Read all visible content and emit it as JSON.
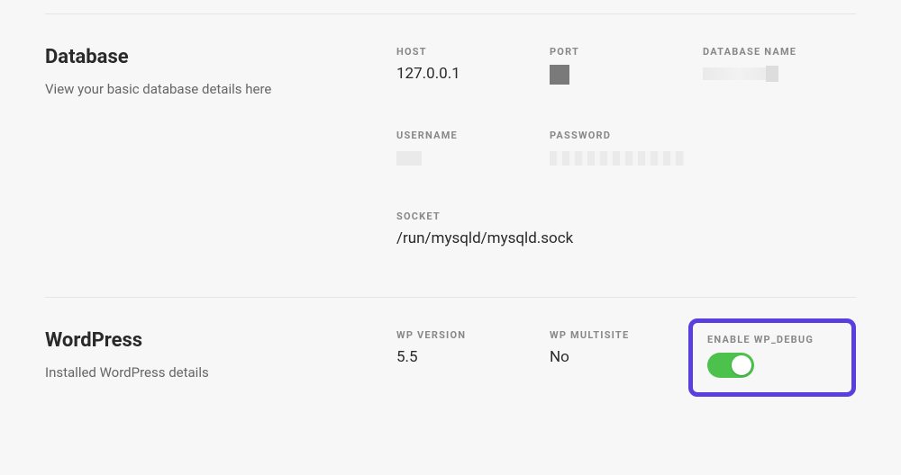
{
  "database": {
    "title": "Database",
    "description": "View your basic database details here",
    "fields": {
      "host": {
        "label": "HOST",
        "value": "127.0.0.1"
      },
      "port": {
        "label": "PORT"
      },
      "database_name": {
        "label": "DATABASE NAME"
      },
      "username": {
        "label": "USERNAME"
      },
      "password": {
        "label": "PASSWORD"
      },
      "socket": {
        "label": "SOCKET",
        "value": "/run/mysqld/mysqld.sock"
      }
    }
  },
  "wordpress": {
    "title": "WordPress",
    "description": "Installed WordPress details",
    "fields": {
      "wp_version": {
        "label": "WP VERSION",
        "value": "5.5"
      },
      "wp_multisite": {
        "label": "WP MULTISITE",
        "value": "No"
      },
      "enable_wp_debug": {
        "label": "ENABLE WP_DEBUG"
      }
    }
  }
}
